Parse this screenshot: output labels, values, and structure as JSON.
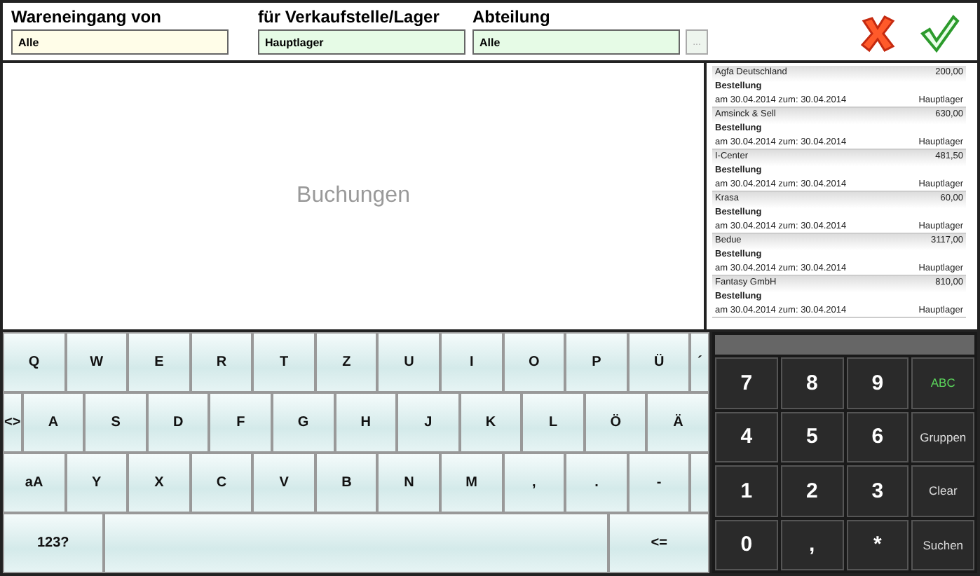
{
  "filters": [
    {
      "label": "Wareneingang von",
      "value": "Alle",
      "kind": "plain"
    },
    {
      "label": "für Verkaufstelle/Lager",
      "value": "Hauptlager",
      "kind": "plain"
    },
    {
      "label": "Abteilung",
      "value": "Alle",
      "kind": "picker",
      "picker": "..."
    }
  ],
  "bookings": {
    "placeholder": "Buchungen"
  },
  "orders": [
    {
      "name": "Agfa Deutschland",
      "amount": "200,00",
      "type": "Bestellung",
      "dates": "am 30.04.2014 zum: 30.04.2014",
      "location": "Hauptlager"
    },
    {
      "name": "Amsinck & Sell",
      "amount": "630,00",
      "type": "Bestellung",
      "dates": "am 30.04.2014 zum: 30.04.2014",
      "location": "Hauptlager"
    },
    {
      "name": "I-Center",
      "amount": "481,50",
      "type": "Bestellung",
      "dates": "am 30.04.2014 zum: 30.04.2014",
      "location": "Hauptlager"
    },
    {
      "name": "Krasa",
      "amount": "60,00",
      "type": "Bestellung",
      "dates": "am 30.04.2014 zum: 30.04.2014",
      "location": "Hauptlager"
    },
    {
      "name": "Bedue",
      "amount": "3117,00",
      "type": "Bestellung",
      "dates": "am 30.04.2014 zum: 30.04.2014",
      "location": "Hauptlager"
    },
    {
      "name": "Fantasy GmbH",
      "amount": "810,00",
      "type": "Bestellung",
      "dates": "am 30.04.2014 zum: 30.04.2014",
      "location": "Hauptlager"
    }
  ],
  "keyboard": [
    [
      {
        "key": "Q",
        "kind": "normal"
      },
      {
        "key": "W",
        "kind": "normal"
      },
      {
        "key": "E",
        "kind": "normal"
      },
      {
        "key": "R",
        "kind": "normal"
      },
      {
        "key": "T",
        "kind": "normal"
      },
      {
        "key": "Z",
        "kind": "normal"
      },
      {
        "key": "U",
        "kind": "normal"
      },
      {
        "key": "I",
        "kind": "normal"
      },
      {
        "key": "O",
        "kind": "normal"
      },
      {
        "key": "P",
        "kind": "normal"
      },
      {
        "key": "Ü",
        "kind": "normal"
      },
      {
        "key": "´",
        "kind": "narrow"
      }
    ],
    [
      {
        "key": "<>",
        "kind": "narrow"
      },
      {
        "key": "A",
        "kind": "normal"
      },
      {
        "key": "S",
        "kind": "normal"
      },
      {
        "key": "D",
        "kind": "normal"
      },
      {
        "key": "F",
        "kind": "normal"
      },
      {
        "key": "G",
        "kind": "normal"
      },
      {
        "key": "H",
        "kind": "normal"
      },
      {
        "key": "J",
        "kind": "normal"
      },
      {
        "key": "K",
        "kind": "normal"
      },
      {
        "key": "L",
        "kind": "normal"
      },
      {
        "key": "Ö",
        "kind": "normal"
      },
      {
        "key": "Ä",
        "kind": "normal"
      }
    ],
    [
      {
        "key": "aA",
        "kind": "normal"
      },
      {
        "key": "Y",
        "kind": "normal"
      },
      {
        "key": "X",
        "kind": "normal"
      },
      {
        "key": "C",
        "kind": "normal"
      },
      {
        "key": "V",
        "kind": "normal"
      },
      {
        "key": "B",
        "kind": "normal"
      },
      {
        "key": "N",
        "kind": "normal"
      },
      {
        "key": "M",
        "kind": "normal"
      },
      {
        "key": ",",
        "kind": "normal"
      },
      {
        "key": ".",
        "kind": "normal"
      },
      {
        "key": "-",
        "kind": "normal"
      },
      {
        "kind": "narrow"
      }
    ],
    [
      {
        "key": "123?",
        "kind": "wide"
      },
      {
        "kind": "space"
      },
      {
        "key": "<=",
        "kind": "wide"
      }
    ]
  ],
  "numpad": [
    {
      "key": "7",
      "kind": "digit",
      "active": false
    },
    {
      "key": "8",
      "kind": "digit",
      "active": false
    },
    {
      "key": "9",
      "kind": "digit",
      "active": false
    },
    {
      "key": "ABC",
      "kind": "command",
      "active": true
    },
    {
      "key": "4",
      "kind": "digit",
      "active": false
    },
    {
      "key": "5",
      "kind": "digit",
      "active": false
    },
    {
      "key": "6",
      "kind": "digit",
      "active": false
    },
    {
      "key": "Gruppen",
      "kind": "command",
      "active": false
    },
    {
      "key": "1",
      "kind": "digit",
      "active": false
    },
    {
      "key": "2",
      "kind": "digit",
      "active": false
    },
    {
      "key": "3",
      "kind": "digit",
      "active": false
    },
    {
      "key": "Clear",
      "kind": "command",
      "active": false
    },
    {
      "key": "0",
      "kind": "digit",
      "active": false
    },
    {
      "key": ",",
      "kind": "digit",
      "active": false
    },
    {
      "key": "*",
      "kind": "digit",
      "active": false
    },
    {
      "key": "Suchen",
      "kind": "command",
      "active": false
    }
  ]
}
